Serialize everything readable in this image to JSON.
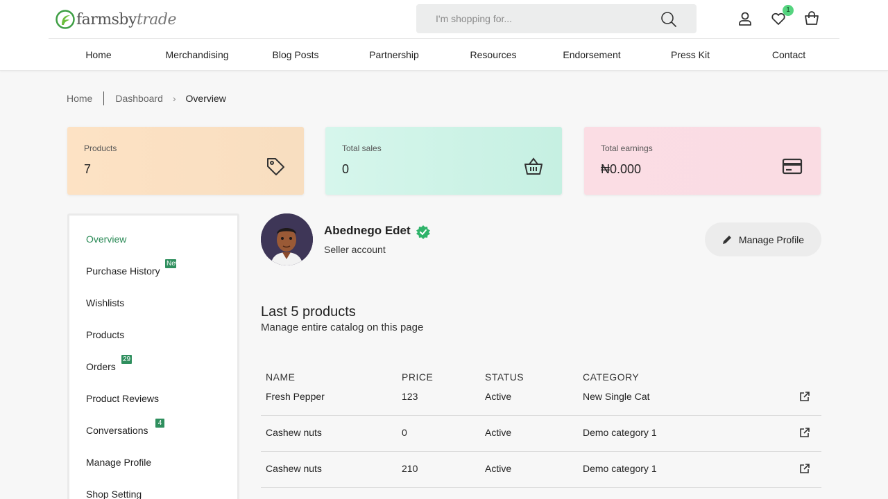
{
  "header": {
    "logo": {
      "part1": "farmsby",
      "part2": "trade"
    },
    "search_placeholder": "I'm shopping for...",
    "wishlist_count": "1"
  },
  "nav": [
    "Home",
    "Merchandising",
    "Blog Posts",
    "Partnership",
    "Resources",
    "Endorsement",
    "Press Kit",
    "Contact"
  ],
  "breadcrumb": {
    "home": "Home",
    "dashboard": "Dashboard",
    "current": "Overview"
  },
  "stats": {
    "products": {
      "label": "Products",
      "value": "7"
    },
    "sales": {
      "label": "Total sales",
      "value": "0"
    },
    "earnings": {
      "label": "Total earnings",
      "value": "₦0.000"
    }
  },
  "sidebar": {
    "items": [
      "Overview",
      "Purchase History",
      "Wishlists",
      "Products",
      "Orders",
      "Product Reviews",
      "Conversations",
      "Manage Profile",
      "Shop Setting"
    ],
    "badges": {
      "purchase_history": "New",
      "orders": "29",
      "conversations": "4"
    }
  },
  "profile": {
    "name": "Abednego Edet",
    "role": "Seller account",
    "manage_label": "Manage Profile"
  },
  "products_section": {
    "title": "Last 5 products",
    "subtitle": "Manage entire catalog on this page",
    "columns": [
      "NAME",
      "PRICE",
      "STATUS",
      "CATEGORY"
    ],
    "rows": [
      {
        "name": "Fresh Pepper",
        "price": "123",
        "status": "Active",
        "category": "New Single Cat"
      },
      {
        "name": "Cashew nuts",
        "price": "0",
        "status": "Active",
        "category": "Demo category 1"
      },
      {
        "name": "Cashew nuts",
        "price": "210",
        "status": "Active",
        "category": "Demo category 1"
      }
    ]
  },
  "colors": {
    "brand_green": "#2a8a56",
    "badge_green": "#2f8f5e",
    "wishlist_badge": "#55d47f"
  }
}
